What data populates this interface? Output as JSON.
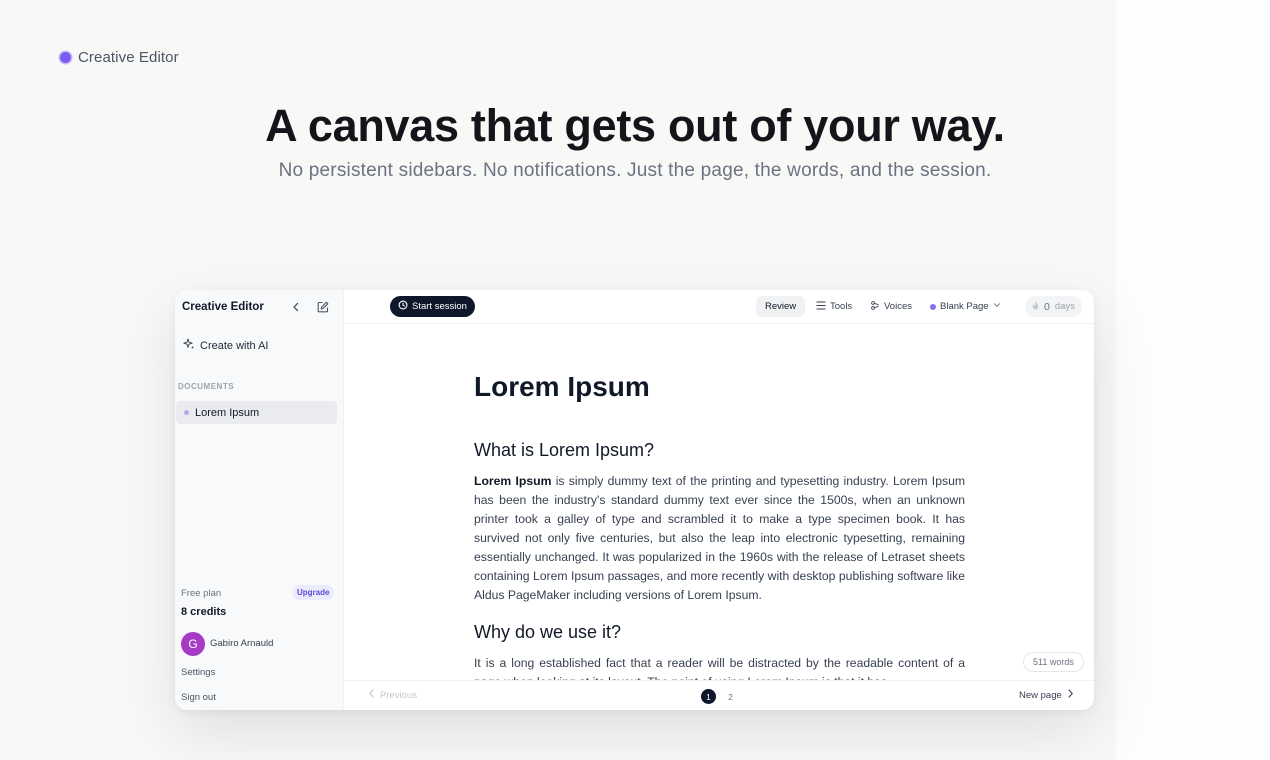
{
  "brand": {
    "name": "Creative Editor",
    "dot_color": "#7c5cf0"
  },
  "hero": {
    "title": "A canvas that gets out of your way.",
    "subtitle": "No persistent sidebars. No notifications. Just the page, the words, and the session."
  },
  "app": {
    "sidebar": {
      "title": "Creative Editor",
      "collapse_icon": "chevron-left-icon",
      "new_doc_icon": "edit-icon",
      "create_ai": "Create with AI",
      "section_label": "DOCUMENTS",
      "documents": [
        {
          "label": "Lorem Ipsum",
          "active": true
        }
      ],
      "plan": "Free plan",
      "upgrade": "Upgrade",
      "credits": "8 credits",
      "user": {
        "initial": "G",
        "name": "Gabiro Arnauld",
        "avatar_color": "#a53bc5"
      },
      "settings": "Settings",
      "sign_out": "Sign out"
    },
    "topbar": {
      "start_session": "Start session",
      "review": "Review",
      "tools": "Tools",
      "voices": "Voices",
      "template": "Blank Page",
      "streak_value": "0",
      "streak_unit": "days"
    },
    "document": {
      "title": "Lorem Ipsum",
      "section1_heading": "What is Lorem Ipsum?",
      "section1_bold": "Lorem Ipsum",
      "section1_body": " is simply dummy text of the printing and typesetting industry. Lorem Ipsum has been the industry's standard dummy text ever since the 1500s, when an unknown printer took a galley of type and scrambled it to make a type specimen book. It has survived not only five centuries, but also the leap into electronic typesetting, remaining essentially unchanged. It was popularized in the 1960s with the release of Letraset sheets containing Lorem Ipsum passages, and more recently with desktop publishing software like Aldus PageMaker including versions of Lorem Ipsum.",
      "section2_heading": "Why do we use it?",
      "section2_body": "It is a long established fact that a reader will be distracted by the readable content of a page when looking at its layout. The point of using Lorem Ipsum is that it has"
    },
    "word_count": "511 words",
    "pagination": {
      "previous": "Previous",
      "pages": [
        "1",
        "2"
      ],
      "current": "1",
      "next": "New page"
    }
  }
}
